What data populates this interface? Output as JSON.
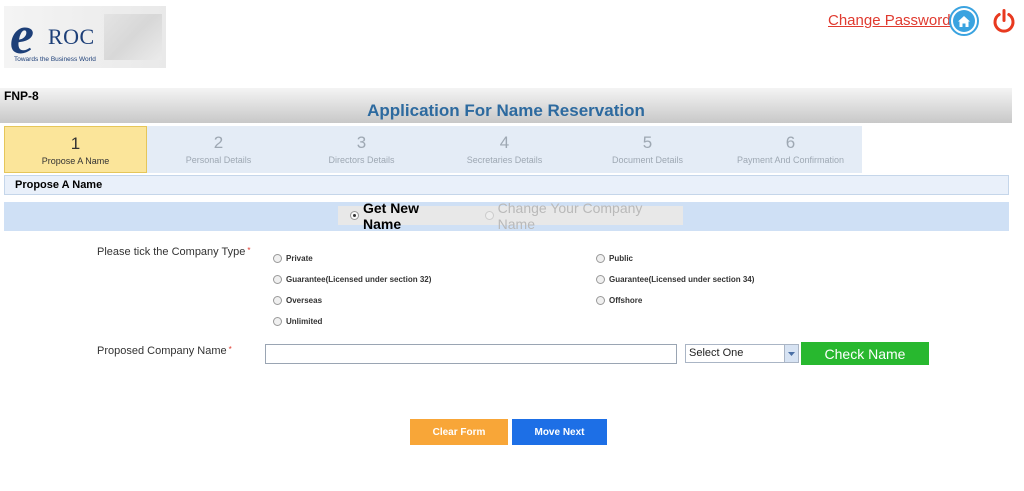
{
  "header": {
    "logo_letter": "e",
    "logo_text": "ROC",
    "logo_tagline": "Towards the Business World",
    "change_password": "Change Password"
  },
  "form": {
    "code": "FNP-8",
    "title": "Application For Name Reservation"
  },
  "steps": [
    {
      "num": "1",
      "label": "Propose A Name"
    },
    {
      "num": "2",
      "label": "Personal Details"
    },
    {
      "num": "3",
      "label": "Directors Details"
    },
    {
      "num": "4",
      "label": "Secretaries Details"
    },
    {
      "num": "5",
      "label": "Document Details"
    },
    {
      "num": "6",
      "label": "Payment And Confirmation"
    }
  ],
  "section_title": "Propose A Name",
  "mode": {
    "option1": "Get New Name",
    "option2": "Change Your Company Name"
  },
  "company_type": {
    "label": "Please tick the Company Type",
    "required": "*",
    "options": [
      "Private",
      "Public",
      "Guarantee(Licensed under section 32)",
      "Guarantee(Licensed under section 34)",
      "Overseas",
      "Offshore",
      "Unlimited"
    ]
  },
  "proposed_name": {
    "label": "Proposed Company Name",
    "required": "*",
    "value": "",
    "select_value": "Select One",
    "check_label": "Check Name"
  },
  "actions": {
    "clear": "Clear Form",
    "next": "Move Next"
  },
  "colors": {
    "accent_blue": "#2d6a9f",
    "active_step": "#fbe59a",
    "check_green": "#28b82f",
    "clear_orange": "#f8a638",
    "next_blue": "#1d6fe6",
    "link_red": "#e03a2f"
  }
}
